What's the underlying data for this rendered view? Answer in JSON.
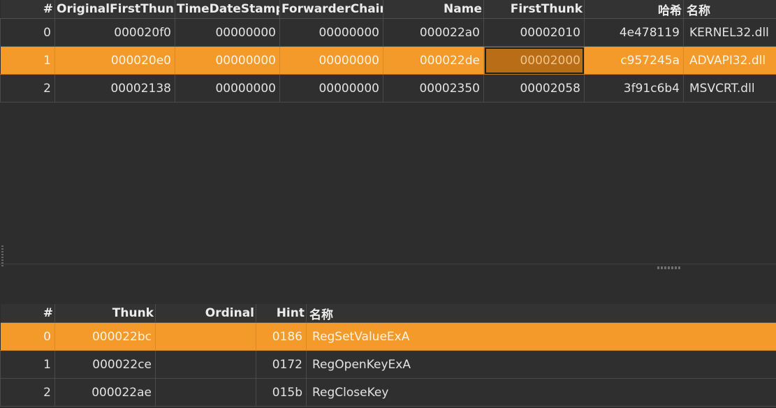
{
  "import_table": {
    "headers": [
      "#",
      "OriginalFirstThunk",
      "TimeDateStamp",
      "ForwarderChain",
      "Name",
      "FirstThunk",
      "哈希",
      "名称"
    ],
    "rows": [
      {
        "idx": "0",
        "oft": "000020f0",
        "tds": "00000000",
        "fc": "00000000",
        "name": "000022a0",
        "ft": "00002010",
        "hash": "4e478119",
        "dll": "KERNEL32.dll"
      },
      {
        "idx": "1",
        "oft": "000020e0",
        "tds": "00000000",
        "fc": "00000000",
        "name": "000022de",
        "ft": "00002000",
        "hash": "c957245a",
        "dll": "ADVAPI32.dll"
      },
      {
        "idx": "2",
        "oft": "00002138",
        "tds": "00000000",
        "fc": "00000000",
        "name": "00002350",
        "ft": "00002058",
        "hash": "3f91c6b4",
        "dll": "MSVCRT.dll"
      }
    ],
    "selected_row": 1
  },
  "function_table": {
    "headers": [
      "#",
      "Thunk",
      "Ordinal",
      "Hint",
      "名称"
    ],
    "rows": [
      {
        "idx": "0",
        "thunk": "000022bc",
        "ordinal": "",
        "hint": "0186",
        "name": "RegSetValueExA"
      },
      {
        "idx": "1",
        "thunk": "000022ce",
        "ordinal": "",
        "hint": "0172",
        "name": "RegOpenKeyExA"
      },
      {
        "idx": "2",
        "thunk": "000022ae",
        "ordinal": "",
        "hint": "015b",
        "name": "RegCloseKey"
      }
    ],
    "selected_row": 0
  },
  "colors": {
    "background": "#2d2d2d",
    "selection": "#f39a2a",
    "focus_cell": "#b96d17"
  }
}
